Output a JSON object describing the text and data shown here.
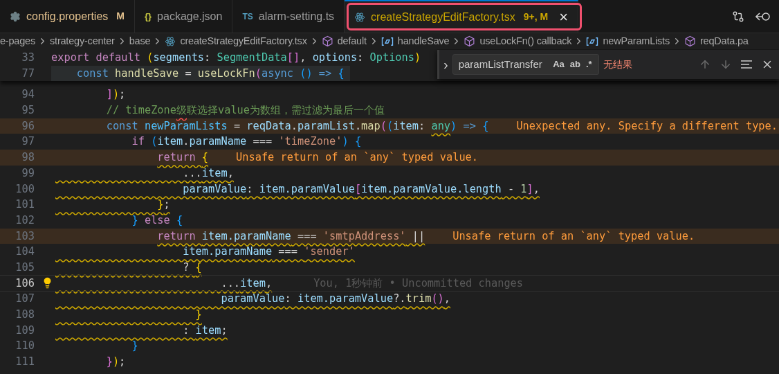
{
  "tabs": [
    {
      "label": "config.properties",
      "icon": {
        "kind": "gear"
      },
      "color": "#e2c08d",
      "badge": "M",
      "selected": false,
      "annotated": false
    },
    {
      "label": "package.json",
      "icon": {
        "kind": "json",
        "text": "{}"
      },
      "color": "#9d9d9d",
      "selected": false,
      "annotated": false
    },
    {
      "label": "alarm-setting.ts",
      "icon": {
        "kind": "ts",
        "text": "TS"
      },
      "color": "#9d9d9d",
      "selected": false,
      "annotated": false
    },
    {
      "label": "createStrategyEditFactory.tsx",
      "icon": {
        "kind": "react"
      },
      "color": "#cca700",
      "badge": "9+, M",
      "selected": true,
      "annotated": true,
      "close": "×"
    }
  ],
  "breadcrumb": [
    {
      "label": "e-pages",
      "kind": "folder"
    },
    {
      "label": "strategy-center",
      "kind": "folder"
    },
    {
      "label": "base",
      "kind": "folder"
    },
    {
      "label": "createStrategyEditFactory.tsx",
      "kind": "file"
    },
    {
      "label": "default",
      "kind": "module"
    },
    {
      "label": "handleSave",
      "kind": "variable"
    },
    {
      "label": "useLockFn() callback",
      "kind": "module"
    },
    {
      "label": "newParamLists",
      "kind": "variable"
    },
    {
      "label": "reqData.pa",
      "kind": "module"
    }
  ],
  "sticky_lines": [
    {
      "number": "33",
      "highlight": false,
      "tokens": [
        {
          "t": "export default ",
          "kind": "keyword"
        },
        {
          "t": "(",
          "kind": "bracket1"
        },
        {
          "t": "segments",
          "kind": "variable"
        },
        {
          "t": ": ",
          "kind": "punctuation"
        },
        {
          "t": "SegmentData",
          "kind": "type"
        },
        {
          "t": "[]",
          "kind": "bracket2"
        },
        {
          "t": ", ",
          "kind": "punctuation"
        },
        {
          "t": "options",
          "kind": "variable"
        },
        {
          "t": ": ",
          "kind": "punctuation"
        },
        {
          "t": "Options",
          "kind": "type"
        },
        {
          "t": ")",
          "kind": "bracket1"
        }
      ]
    },
    {
      "number": "77",
      "highlight": true,
      "tokens": [
        {
          "t": "    const ",
          "kind": "storage"
        },
        {
          "t": "handleSave",
          "kind": "function"
        },
        {
          "t": " = ",
          "kind": "punctuation"
        },
        {
          "t": "useLockFn",
          "kind": "function"
        },
        {
          "t": "(",
          "kind": "bracket2"
        },
        {
          "t": "async ",
          "kind": "storage"
        },
        {
          "t": "()",
          "kind": "bracket3"
        },
        {
          "t": " => ",
          "kind": "storage"
        },
        {
          "t": "{",
          "kind": "bracket3"
        }
      ]
    }
  ],
  "find_widget": {
    "toggle": "›",
    "query": "paramListTransfer",
    "options": [
      {
        "label": "Aa",
        "selected": false
      },
      {
        "label": "ab",
        "selected": false
      },
      {
        "label": ".*",
        "selected": false
      }
    ],
    "result": "无结果"
  },
  "lines": [
    {
      "number": "94",
      "current": false,
      "tokens": [
        {
          "t": "        ]",
          "kind": "bracket2"
        },
        {
          "t": ")",
          "kind": "bracket1"
        },
        {
          "t": ";",
          "kind": "punctuation"
        }
      ]
    },
    {
      "number": "95",
      "current": false,
      "tokens": [
        {
          "t": "        // timeZone",
          "kind": "comment"
        },
        {
          "t": "级",
          "kind": "comment",
          "misspelled": true
        },
        {
          "t": "联选择value为数组，需过滤为最后一个值",
          "kind": "comment"
        }
      ]
    },
    {
      "number": "96",
      "current": false,
      "message": "Unexpected any. Specify a different type.",
      "tokens": [
        {
          "t": "        const ",
          "kind": "storage"
        },
        {
          "t": "newParamLists",
          "kind": "constant"
        },
        {
          "t": " = ",
          "kind": "punctuation"
        },
        {
          "t": "reqData",
          "kind": "variable"
        },
        {
          "t": ".",
          "kind": "punctuation"
        },
        {
          "t": "paramList",
          "kind": "variable"
        },
        {
          "t": ".",
          "kind": "punctuation"
        },
        {
          "t": "map",
          "kind": "function"
        },
        {
          "t": "(",
          "kind": "bracket2"
        },
        {
          "t": "(",
          "kind": "bracket3"
        },
        {
          "t": "item",
          "kind": "variable"
        },
        {
          "t": ": ",
          "kind": "punctuation"
        },
        {
          "t": "any",
          "kind": "type",
          "warning": true
        },
        {
          "t": ")",
          "kind": "bracket3"
        },
        {
          "t": " => ",
          "kind": "storage"
        },
        {
          "t": "{",
          "kind": "bracket3"
        }
      ]
    },
    {
      "number": "97",
      "current": false,
      "tokens": [
        {
          "t": "            if ",
          "kind": "keyword"
        },
        {
          "t": "(",
          "kind": "bracket3"
        },
        {
          "t": "item",
          "kind": "variable"
        },
        {
          "t": ".",
          "kind": "punctuation"
        },
        {
          "t": "paramName",
          "kind": "variable"
        },
        {
          "t": " === ",
          "kind": "punctuation"
        },
        {
          "t": "'timeZone'",
          "kind": "string"
        },
        {
          "t": ") {",
          "kind": "bracket3"
        }
      ]
    },
    {
      "number": "98",
      "current": false,
      "squiggle_indent": false,
      "message": "Unsafe return of an `any` typed value.",
      "tokens": [
        {
          "t": "                return ",
          "kind": "keyword",
          "warning": true
        },
        {
          "t": "{",
          "kind": "bracket1",
          "warning": true
        }
      ]
    },
    {
      "number": "99",
      "current": false,
      "squiggle_indent": true,
      "tokens": [
        {
          "t": "                    ...",
          "kind": "punctuation",
          "warning": true
        },
        {
          "t": "item",
          "kind": "variable",
          "warning": true
        },
        {
          "t": ",",
          "kind": "punctuation",
          "warning": true
        }
      ]
    },
    {
      "number": "100",
      "current": false,
      "squiggle_indent": true,
      "tokens": [
        {
          "t": "                    paramValue",
          "kind": "variable",
          "warning": true
        },
        {
          "t": ": ",
          "kind": "punctuation",
          "warning": true
        },
        {
          "t": "item.paramValue",
          "kind": "variable",
          "warning": true
        },
        {
          "t": "[",
          "kind": "bracket2",
          "warning": true
        },
        {
          "t": "item.paramValue.length",
          "kind": "variable",
          "warning": true
        },
        {
          "t": " - ",
          "kind": "punctuation",
          "warning": true
        },
        {
          "t": "1",
          "kind": "number",
          "warning": true
        },
        {
          "t": "]",
          "kind": "bracket2",
          "warning": true
        },
        {
          "t": ",",
          "kind": "punctuation",
          "warning": true
        }
      ]
    },
    {
      "number": "101",
      "current": false,
      "squiggle_indent": true,
      "tokens": [
        {
          "t": "                }",
          "kind": "bracket1",
          "warning": true
        },
        {
          "t": ";",
          "kind": "punctuation",
          "warning": true
        }
      ]
    },
    {
      "number": "102",
      "current": false,
      "tokens": [
        {
          "t": "            }",
          "kind": "bracket3"
        },
        {
          "t": " else ",
          "kind": "keyword"
        },
        {
          "t": "{",
          "kind": "bracket3"
        }
      ]
    },
    {
      "number": "103",
      "current": false,
      "squiggle_indent": false,
      "message": "Unsafe return of an `any` typed value.",
      "tokens": [
        {
          "t": "                return ",
          "kind": "keyword",
          "warning": true
        },
        {
          "t": "item.paramName",
          "kind": "variable",
          "warning": true
        },
        {
          "t": " === ",
          "kind": "punctuation",
          "warning": true
        },
        {
          "t": "'smtpAddress'",
          "kind": "string",
          "warning": true
        },
        {
          "t": " ||",
          "kind": "punctuation",
          "warning": true
        }
      ]
    },
    {
      "number": "104",
      "current": false,
      "squiggle_indent": true,
      "tokens": [
        {
          "t": "                    item.paramName",
          "kind": "variable",
          "warning": true
        },
        {
          "t": " === ",
          "kind": "punctuation",
          "warning": true
        },
        {
          "t": "'sender'",
          "kind": "string",
          "warning": true
        }
      ]
    },
    {
      "number": "105",
      "current": false,
      "squiggle_indent": true,
      "tokens": [
        {
          "t": "                    ? ",
          "kind": "punctuation",
          "warning": true
        },
        {
          "t": "{",
          "kind": "bracket1",
          "warning": true
        }
      ]
    },
    {
      "number": "106",
      "current": true,
      "squiggle_indent": true,
      "lightbulb": true,
      "blame": "You, 1秒钟前 • Uncommitted changes",
      "tokens": [
        {
          "t": "                          ...",
          "kind": "punctuation",
          "warning": true
        },
        {
          "t": "item",
          "kind": "variable",
          "warning": true
        },
        {
          "t": ",",
          "kind": "punctuation",
          "warning": true
        }
      ]
    },
    {
      "number": "107",
      "current": false,
      "squiggle_indent": true,
      "tokens": [
        {
          "t": "                          paramValue",
          "kind": "variable",
          "warning": true
        },
        {
          "t": ": ",
          "kind": "punctuation",
          "warning": true
        },
        {
          "t": "item.paramValue",
          "kind": "variable",
          "warning": true
        },
        {
          "t": "?.",
          "kind": "punctuation",
          "warning": true
        },
        {
          "t": "trim",
          "kind": "function",
          "warning": true
        },
        {
          "t": "()",
          "kind": "bracket2",
          "warning": true
        },
        {
          "t": ",",
          "kind": "punctuation",
          "warning": true
        }
      ]
    },
    {
      "number": "108",
      "current": false,
      "squiggle_indent": true,
      "tokens": [
        {
          "t": "                      }",
          "kind": "bracket1",
          "warning": true
        }
      ]
    },
    {
      "number": "109",
      "current": false,
      "squiggle_indent": true,
      "tokens": [
        {
          "t": "                    : ",
          "kind": "punctuation",
          "warning": true
        },
        {
          "t": "item",
          "kind": "variable",
          "warning": true
        },
        {
          "t": ";",
          "kind": "punctuation",
          "warning": true
        }
      ]
    },
    {
      "number": "110",
      "current": false,
      "tokens": [
        {
          "t": "            }",
          "kind": "bracket3"
        }
      ]
    },
    {
      "number": "111",
      "current": false,
      "tokens": [
        {
          "t": "        }",
          "kind": "bracket2"
        },
        {
          "t": ")",
          "kind": "bracket1"
        },
        {
          "t": ";",
          "kind": "punctuation"
        }
      ]
    }
  ]
}
